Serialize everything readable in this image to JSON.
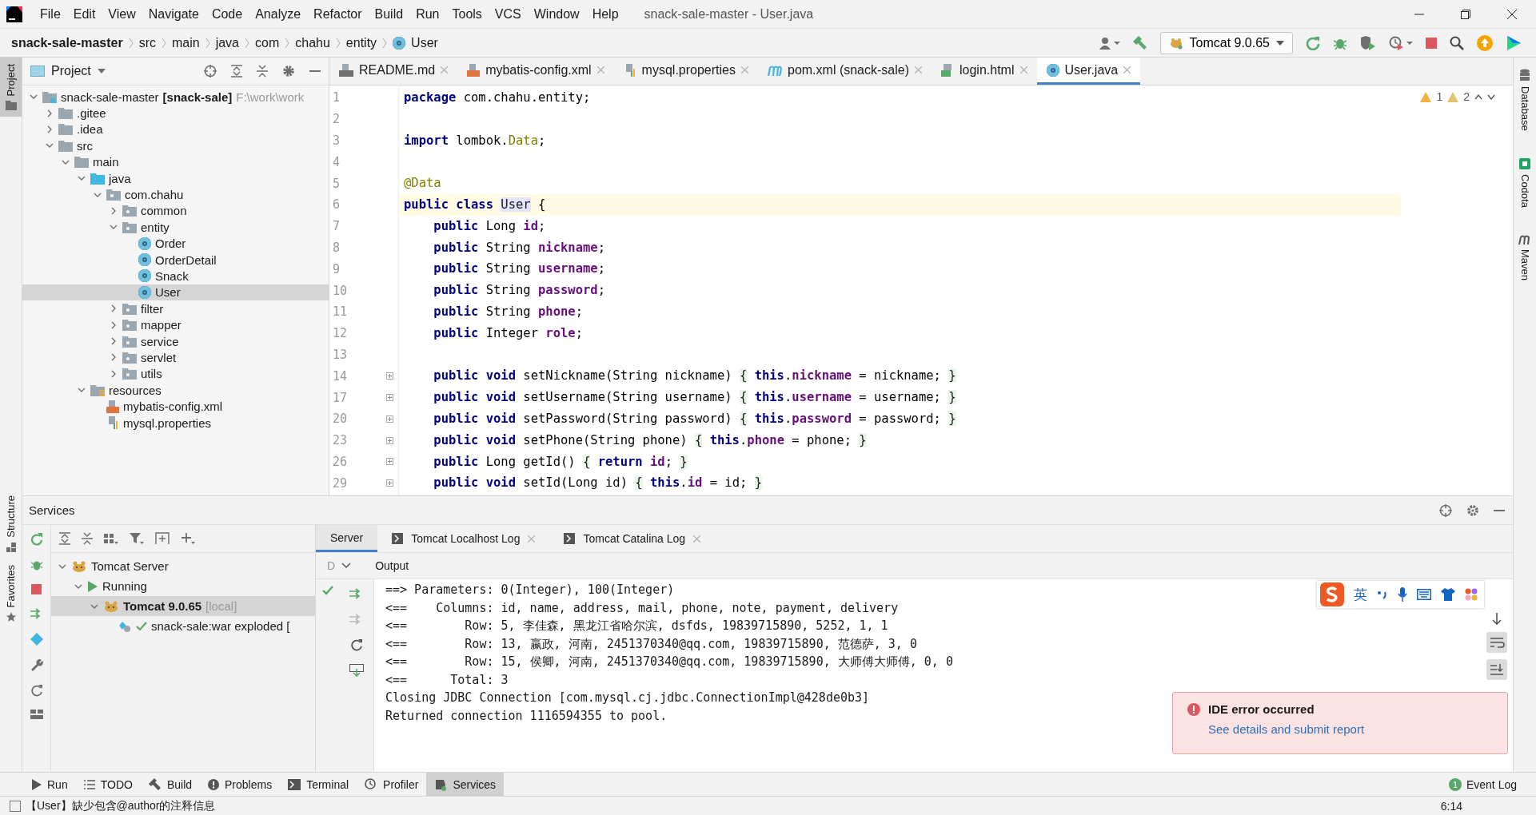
{
  "menu": [
    "File",
    "Edit",
    "View",
    "Navigate",
    "Code",
    "Analyze",
    "Refactor",
    "Build",
    "Run",
    "Tools",
    "VCS",
    "Window",
    "Help"
  ],
  "window_title": "snack-sale-master - User.java",
  "breadcrumb": [
    {
      "label": "snack-sale-master",
      "kind": "project"
    },
    {
      "label": "src",
      "kind": "dir"
    },
    {
      "label": "main",
      "kind": "dir"
    },
    {
      "label": "java",
      "kind": "dir"
    },
    {
      "label": "com",
      "kind": "dir"
    },
    {
      "label": "chahu",
      "kind": "dir"
    },
    {
      "label": "entity",
      "kind": "dir"
    },
    {
      "label": "User",
      "kind": "class"
    }
  ],
  "run_config": "Tomcat 9.0.65",
  "left_stripe": [
    {
      "label": "Project",
      "selected": true
    },
    {
      "label": "Structure",
      "selected": false
    },
    {
      "label": "Favorites",
      "selected": false
    }
  ],
  "right_stripe": [
    "Database",
    "Codota",
    "Maven"
  ],
  "project_panel": {
    "title": "Project",
    "tree": [
      {
        "label": "snack-sale-master",
        "module": "[snack-sale]",
        "path": "F:\\work\\work",
        "kind": "module",
        "expanded": true,
        "selected": false,
        "children": [
          {
            "label": ".gitee",
            "kind": "folder",
            "expanded": false,
            "selected": false
          },
          {
            "label": ".idea",
            "kind": "folder",
            "expanded": false,
            "selected": false
          },
          {
            "label": "src",
            "kind": "folder",
            "expanded": true,
            "selected": false,
            "children": [
              {
                "label": "main",
                "kind": "folder",
                "expanded": true,
                "selected": false,
                "children": [
                  {
                    "label": "java",
                    "kind": "source",
                    "expanded": true,
                    "selected": false,
                    "children": [
                      {
                        "label": "com.chahu",
                        "kind": "package",
                        "expanded": true,
                        "selected": false,
                        "children": [
                          {
                            "label": "common",
                            "kind": "package",
                            "expanded": false,
                            "selected": false
                          },
                          {
                            "label": "entity",
                            "kind": "package",
                            "expanded": true,
                            "selected": false,
                            "children": [
                              {
                                "label": "Order",
                                "kind": "class",
                                "selected": false
                              },
                              {
                                "label": "OrderDetail",
                                "kind": "class",
                                "selected": false
                              },
                              {
                                "label": "Snack",
                                "kind": "class",
                                "selected": false
                              },
                              {
                                "label": "User",
                                "kind": "class",
                                "selected": true
                              }
                            ]
                          },
                          {
                            "label": "filter",
                            "kind": "package",
                            "expanded": false,
                            "selected": false
                          },
                          {
                            "label": "mapper",
                            "kind": "package",
                            "expanded": false,
                            "selected": false
                          },
                          {
                            "label": "service",
                            "kind": "package",
                            "expanded": false,
                            "selected": false
                          },
                          {
                            "label": "servlet",
                            "kind": "package",
                            "expanded": false,
                            "selected": false
                          },
                          {
                            "label": "utils",
                            "kind": "package",
                            "expanded": false,
                            "selected": false
                          }
                        ]
                      }
                    ]
                  },
                  {
                    "label": "resources",
                    "kind": "resources",
                    "expanded": true,
                    "selected": false,
                    "children": [
                      {
                        "label": "mybatis-config.xml",
                        "kind": "xml",
                        "selected": false
                      },
                      {
                        "label": "mysql.properties",
                        "kind": "properties",
                        "selected": false
                      }
                    ]
                  }
                ]
              }
            ]
          }
        ]
      }
    ]
  },
  "editor_tabs": [
    {
      "label": "README.md",
      "kind": "md",
      "selected": false
    },
    {
      "label": "mybatis-config.xml",
      "kind": "xml",
      "selected": false
    },
    {
      "label": "mysql.properties",
      "kind": "properties",
      "selected": false
    },
    {
      "label": "pom.xml (snack-sale)",
      "kind": "maven",
      "selected": false
    },
    {
      "label": "login.html",
      "kind": "html",
      "selected": false
    },
    {
      "label": "User.java",
      "kind": "class",
      "selected": true
    }
  ],
  "inspections": {
    "warnings": "1",
    "weak_warnings": "2"
  },
  "code_lines": [
    {
      "num": "1",
      "current": false,
      "folded": false,
      "tokens": [
        {
          "kind": "kw",
          "text": "package"
        },
        {
          "kind": "plain",
          "text": " com.chahu.entity;"
        }
      ]
    },
    {
      "num": "2",
      "current": false,
      "folded": false
    },
    {
      "num": "3",
      "current": false,
      "folded": false,
      "tokens": [
        {
          "kind": "kw",
          "text": "import"
        },
        {
          "kind": "plain",
          "text": " lombok."
        },
        {
          "kind": "ann",
          "text": "Data"
        },
        {
          "kind": "plain",
          "text": ";"
        }
      ]
    },
    {
      "num": "4",
      "current": false,
      "folded": false
    },
    {
      "num": "5",
      "current": false,
      "folded": false,
      "tokens": [
        {
          "kind": "ann",
          "text": "@Data"
        }
      ]
    },
    {
      "num": "6",
      "current": true,
      "folded": false,
      "tokens": [
        {
          "kind": "kw",
          "text": "public class "
        },
        {
          "kind": "hl",
          "text": "User"
        },
        {
          "kind": "plain",
          "text": " {"
        }
      ]
    },
    {
      "num": "7",
      "current": false,
      "folded": false,
      "tokens": [
        {
          "kind": "kw",
          "text": "    public"
        },
        {
          "kind": "plain",
          "text": " Long "
        },
        {
          "kind": "field",
          "text": "id"
        },
        {
          "kind": "plain",
          "text": ";"
        }
      ]
    },
    {
      "num": "8",
      "current": false,
      "folded": false,
      "tokens": [
        {
          "kind": "kw",
          "text": "    public"
        },
        {
          "kind": "plain",
          "text": " String "
        },
        {
          "kind": "field",
          "text": "nickname"
        },
        {
          "kind": "plain",
          "text": ";"
        }
      ]
    },
    {
      "num": "9",
      "current": false,
      "folded": false,
      "tokens": [
        {
          "kind": "kw",
          "text": "    public"
        },
        {
          "kind": "plain",
          "text": " String "
        },
        {
          "kind": "field",
          "text": "username"
        },
        {
          "kind": "plain",
          "text": ";"
        }
      ]
    },
    {
      "num": "10",
      "current": false,
      "folded": false,
      "tokens": [
        {
          "kind": "kw",
          "text": "    public"
        },
        {
          "kind": "plain",
          "text": " String "
        },
        {
          "kind": "field",
          "text": "password"
        },
        {
          "kind": "plain",
          "text": ";"
        }
      ]
    },
    {
      "num": "11",
      "current": false,
      "folded": false,
      "tokens": [
        {
          "kind": "kw",
          "text": "    public"
        },
        {
          "kind": "plain",
          "text": " String "
        },
        {
          "kind": "field",
          "text": "phone"
        },
        {
          "kind": "plain",
          "text": ";"
        }
      ]
    },
    {
      "num": "12",
      "current": false,
      "folded": false,
      "tokens": [
        {
          "kind": "kw",
          "text": "    public"
        },
        {
          "kind": "plain",
          "text": " Integer "
        },
        {
          "kind": "field",
          "text": "role"
        },
        {
          "kind": "plain",
          "text": ";"
        }
      ]
    },
    {
      "num": "13",
      "current": false,
      "folded": false
    },
    {
      "num": "14",
      "current": false,
      "folded": true,
      "tokens": [
        {
          "kind": "kw",
          "text": "    public void"
        },
        {
          "kind": "plain",
          "text": " setNickname(String nickname) "
        },
        {
          "kind": "fold",
          "text": "{"
        },
        {
          "kind": "kw",
          "text": " this"
        },
        {
          "kind": "plain",
          "text": "."
        },
        {
          "kind": "field",
          "text": "nickname"
        },
        {
          "kind": "plain",
          "text": " = nickname; "
        },
        {
          "kind": "fold",
          "text": "}"
        }
      ]
    },
    {
      "num": "17",
      "current": false,
      "folded": true,
      "tokens": [
        {
          "kind": "kw",
          "text": "    public void"
        },
        {
          "kind": "plain",
          "text": " setUsername(String username) "
        },
        {
          "kind": "fold",
          "text": "{"
        },
        {
          "kind": "kw",
          "text": " this"
        },
        {
          "kind": "plain",
          "text": "."
        },
        {
          "kind": "field",
          "text": "username"
        },
        {
          "kind": "plain",
          "text": " = username; "
        },
        {
          "kind": "fold",
          "text": "}"
        }
      ]
    },
    {
      "num": "20",
      "current": false,
      "folded": true,
      "tokens": [
        {
          "kind": "kw",
          "text": "    public void"
        },
        {
          "kind": "plain",
          "text": " setPassword(String password) "
        },
        {
          "kind": "fold",
          "text": "{"
        },
        {
          "kind": "kw",
          "text": " this"
        },
        {
          "kind": "plain",
          "text": "."
        },
        {
          "kind": "field",
          "text": "password"
        },
        {
          "kind": "plain",
          "text": " = password; "
        },
        {
          "kind": "fold",
          "text": "}"
        }
      ]
    },
    {
      "num": "23",
      "current": false,
      "folded": true,
      "tokens": [
        {
          "kind": "kw",
          "text": "    public void"
        },
        {
          "kind": "plain",
          "text": " setPhone(String phone) "
        },
        {
          "kind": "fold",
          "text": "{"
        },
        {
          "kind": "kw",
          "text": " this"
        },
        {
          "kind": "plain",
          "text": "."
        },
        {
          "kind": "field",
          "text": "phone"
        },
        {
          "kind": "plain",
          "text": " = phone; "
        },
        {
          "kind": "fold",
          "text": "}"
        }
      ]
    },
    {
      "num": "26",
      "current": false,
      "folded": true,
      "tokens": [
        {
          "kind": "kw",
          "text": "    public"
        },
        {
          "kind": "plain",
          "text": " Long getId() "
        },
        {
          "kind": "fold",
          "text": "{"
        },
        {
          "kind": "kw",
          "text": " return "
        },
        {
          "kind": "field",
          "text": "id"
        },
        {
          "kind": "plain",
          "text": "; "
        },
        {
          "kind": "fold",
          "text": "}"
        }
      ]
    },
    {
      "num": "29",
      "current": false,
      "folded": true,
      "tokens": [
        {
          "kind": "kw",
          "text": "    public void"
        },
        {
          "kind": "plain",
          "text": " setId(Long id) "
        },
        {
          "kind": "fold",
          "text": "{"
        },
        {
          "kind": "kw",
          "text": " this"
        },
        {
          "kind": "plain",
          "text": "."
        },
        {
          "kind": "field",
          "text": "id"
        },
        {
          "kind": "plain",
          "text": " = id; "
        },
        {
          "kind": "fold",
          "text": "}"
        }
      ]
    }
  ],
  "services": {
    "title": "Services",
    "tree": [
      {
        "label": "Tomcat Server",
        "kind": "tomcat",
        "expanded": true,
        "selected": false,
        "children": [
          {
            "label": "Running",
            "kind": "running",
            "expanded": true,
            "selected": false,
            "children": [
              {
                "label": "Tomcat 9.0.65",
                "suffix": "[local]",
                "kind": "tomcat",
                "expanded": true,
                "selected": true,
                "children": [
                  {
                    "label": "snack-sale:war exploded [",
                    "kind": "artifact",
                    "selected": false
                  }
                ]
              }
            ]
          }
        ]
      }
    ],
    "tabs": [
      {
        "label": "Server",
        "closable": false,
        "selected": true
      },
      {
        "label": "Tomcat Localhost Log",
        "closable": true,
        "selected": false
      },
      {
        "label": "Tomcat Catalina Log",
        "closable": true,
        "selected": false
      }
    ],
    "deploy_header": "D",
    "output_header": "Output",
    "output_lines": [
      "==> Parameters: 0(Integer), 100(Integer)",
      "<==    Columns: id, name, address, mail, phone, note, payment, delivery",
      "<==        Row: 5, 李佳森, 黑龙江省哈尔滨, dsfds, 19839715890, 5252, 1, 1",
      "<==        Row: 13, 嬴政, 河南, 2451370340@qq.com, 19839715890, 范德萨, 3, 0",
      "<==        Row: 15, 侯卿, 河南, 2451370340@qq.com, 19839715890, 大师傅大师傅, 0, 0",
      "<==      Total: 3",
      "Closing JDBC Connection [com.mysql.cj.jdbc.ConnectionImpl@428de0b3]",
      "Returned connection 1116594355 to pool."
    ]
  },
  "ime": {
    "label": "英"
  },
  "notification": {
    "title": "IDE error occurred",
    "link": "See details and submit report"
  },
  "bottom_tools": [
    {
      "label": "Run",
      "kind": "run",
      "selected": false
    },
    {
      "label": "TODO",
      "kind": "list",
      "selected": false
    },
    {
      "label": "Build",
      "kind": "hammer",
      "selected": false
    },
    {
      "label": "Problems",
      "kind": "problem",
      "selected": false
    },
    {
      "label": "Terminal",
      "kind": "terminal",
      "selected": false
    },
    {
      "label": "Profiler",
      "kind": "profiler",
      "selected": false
    },
    {
      "label": "Services",
      "kind": "services",
      "selected": true
    }
  ],
  "event_log": {
    "count": "1",
    "label": "Event Log"
  },
  "status": {
    "message": "【User】缺少包含@author的注释信息",
    "time": "6:14"
  }
}
